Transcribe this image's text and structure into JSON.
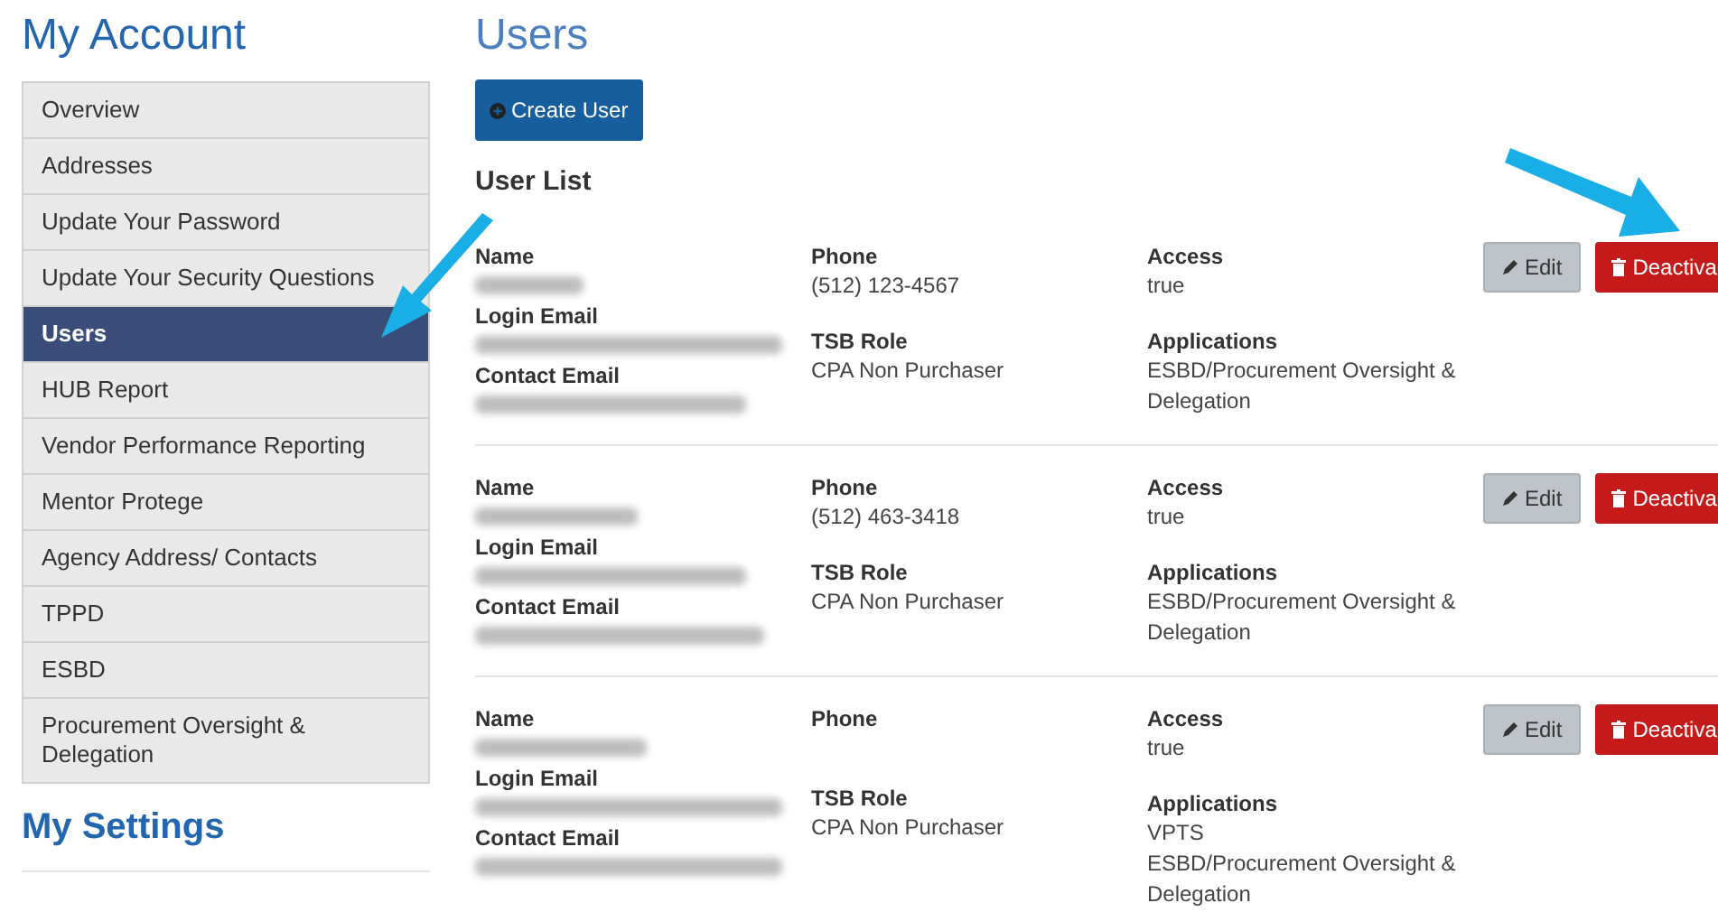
{
  "sidebar": {
    "title": "My Account",
    "items": [
      {
        "label": "Overview",
        "selected": false
      },
      {
        "label": "Addresses",
        "selected": false
      },
      {
        "label": "Update Your Password",
        "selected": false
      },
      {
        "label": "Update Your Security Questions",
        "selected": false
      },
      {
        "label": "Users",
        "selected": true
      },
      {
        "label": "HUB Report",
        "selected": false
      },
      {
        "label": "Vendor Performance Reporting",
        "selected": false
      },
      {
        "label": "Mentor Protege",
        "selected": false
      },
      {
        "label": "Agency Address/ Contacts",
        "selected": false
      },
      {
        "label": "TPPD",
        "selected": false
      },
      {
        "label": "ESBD",
        "selected": false
      },
      {
        "label": "Procurement Oversight & Delegation",
        "selected": false
      }
    ],
    "settings_title": "My Settings"
  },
  "main": {
    "title": "Users",
    "create_button": "Create User",
    "list_title": "User List"
  },
  "users": [
    {
      "name_label": "Name",
      "login_label": "Login Email",
      "contact_label": "Contact Email",
      "phone_label": "Phone",
      "phone": "(512) 123-4567",
      "role_label": "TSB Role",
      "role": "CPA Non Purchaser",
      "access_label": "Access",
      "access": "true",
      "apps_label": "Applications",
      "applications": [
        "ESBD/Procurement Oversight & Delegation"
      ],
      "edit": "Edit",
      "deactivate": "Deactiva"
    },
    {
      "name_label": "Name",
      "login_label": "Login Email",
      "contact_label": "Contact Email",
      "phone_label": "Phone",
      "phone": "(512) 463-3418",
      "role_label": "TSB Role",
      "role": "CPA Non Purchaser",
      "access_label": "Access",
      "access": "true",
      "apps_label": "Applications",
      "applications": [
        "ESBD/Procurement Oversight & Delegation"
      ],
      "edit": "Edit",
      "deactivate": "Deactiva"
    },
    {
      "name_label": "Name",
      "login_label": "Login Email",
      "contact_label": "Contact Email",
      "phone_label": "Phone",
      "role_label": "TSB Role",
      "role": "CPA Non Purchaser",
      "access_label": "Access",
      "access": "true",
      "apps_label": "Applications",
      "applications": [
        "VPTS",
        "ESBD/Procurement Oversight & Delegation"
      ],
      "edit": "Edit",
      "deactivate": "Deactiva"
    }
  ]
}
